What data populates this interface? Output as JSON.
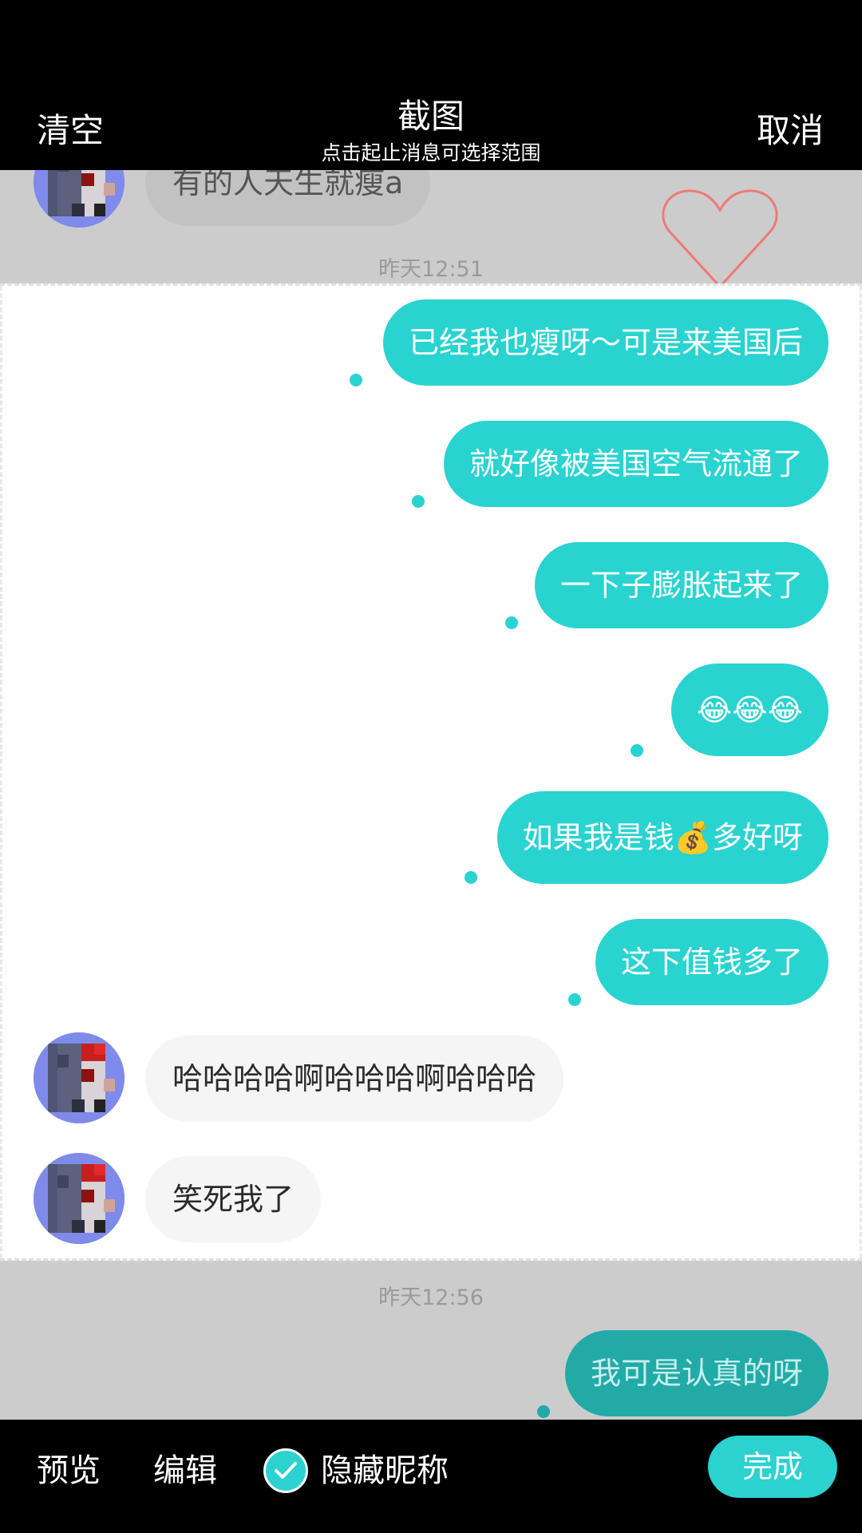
{
  "header": {
    "clear_label": "清空",
    "title": "截图",
    "subtitle": "点击起止消息可选择范围",
    "cancel_label": "取消"
  },
  "chat": {
    "top_partial_message": "有的人天生就瘦a",
    "timestamp_1": "昨天12:51",
    "outgoing": [
      "已经我也瘦呀～可是来美国后",
      "就好像被美国空气流通了",
      "一下子膨胀起来了",
      "😂😂😂",
      "如果我是钱💰多好呀",
      "这下值钱多了"
    ],
    "incoming": [
      "哈哈哈哈啊哈哈哈啊哈哈哈",
      "笑死我了"
    ],
    "timestamp_2": "昨天12:56",
    "last_outgoing": "我可是认真的呀"
  },
  "icons": {
    "heart": "heart-outline-icon",
    "check": "checkmark-icon",
    "avatar": "pixelated-avatar"
  },
  "colors": {
    "accent": "#29d3d0",
    "selection_bg": "#ffffff",
    "unselected_bg": "#cccccc",
    "bar_bg": "#000000",
    "heart": "#f07878"
  },
  "footer": {
    "preview_label": "预览",
    "edit_label": "编辑",
    "hide_nickname_label": "隐藏昵称",
    "hide_nickname_checked": true,
    "done_label": "完成"
  }
}
